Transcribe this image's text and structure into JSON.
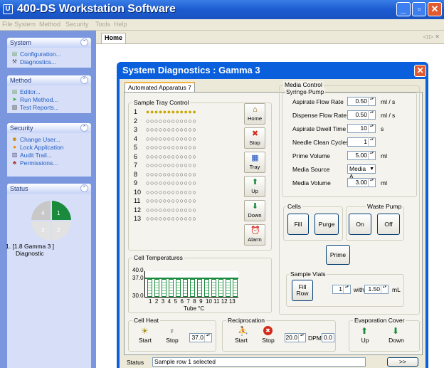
{
  "window": {
    "title": "400-DS Workstation Software",
    "icon_text": "U",
    "min": "_",
    "max": "▫",
    "close": "✕"
  },
  "menu": [
    "File",
    "System",
    "Method",
    "Security",
    "Tools",
    "Help"
  ],
  "sidebar": {
    "system": {
      "title": "System",
      "items": [
        "Configuration...",
        "Diagnostics..."
      ]
    },
    "method": {
      "title": "Method",
      "items": [
        "Editor...",
        "Run Method...",
        "Test Reports..."
      ]
    },
    "security": {
      "title": "Security",
      "items": [
        "Change User...",
        "Lock Application",
        "Audit Trail...",
        "Permissions..."
      ]
    },
    "status": {
      "title": "Status",
      "pie": [
        "4",
        "1",
        "3",
        "2"
      ],
      "line1": "1. [1.8 Gamma 3 ]",
      "line2": "Diagnostic"
    }
  },
  "main": {
    "tab": "Home",
    "nav": "◁ ▷ ✕"
  },
  "dialog": {
    "title": "System Diagnostics : Gamma 3",
    "tab": "Automated Apparatus 7",
    "tray": {
      "title": "Sample Tray Control",
      "rows": [
        "1",
        "2",
        "3",
        "4",
        "5",
        "6",
        "7",
        "8",
        "9",
        "10",
        "11",
        "12",
        "13"
      ],
      "buttons": [
        {
          "label": "Home",
          "icon": "home-icon",
          "glyph": "⌂"
        },
        {
          "label": "Stop",
          "icon": "stop-icon",
          "glyph": "✖"
        },
        {
          "label": "Tray",
          "icon": "tray-icon",
          "glyph": "▦"
        },
        {
          "label": "Up",
          "icon": "up-arrow-icon",
          "glyph": "⬆"
        },
        {
          "label": "Down",
          "icon": "down-arrow-icon",
          "glyph": "⬇"
        },
        {
          "label": "Alarm",
          "icon": "alarm-icon",
          "glyph": "⏰"
        }
      ]
    },
    "temps": {
      "title": "Cell Temperatures",
      "y_top": "40.0",
      "y_mid": "37.0",
      "y_bot": "30.0",
      "ticks": "1  2  3  4  5  6  7  8  9  10 11 12 13",
      "xlabel": "Tube °C"
    },
    "media": {
      "title": "Media Control",
      "syringe": "Syringe Pump",
      "fields": [
        {
          "label": "Aspirate Flow Rate",
          "value": "0.50",
          "unit": "ml / s"
        },
        {
          "label": "Dispense Flow Rate",
          "value": "0.50",
          "unit": "ml / s"
        },
        {
          "label": "Aspirate Dwell Time",
          "value": "10",
          "unit": "s"
        },
        {
          "label": "Needle Clean Cycles",
          "value": "1",
          "unit": ""
        },
        {
          "label": "Prime Volume",
          "value": "5.00",
          "unit": "ml"
        },
        {
          "label": "Media Source",
          "value": "Media A",
          "unit": ""
        },
        {
          "label": "Media Volume",
          "value": "3.00",
          "unit": "ml"
        }
      ]
    },
    "cells": {
      "title": "Cells",
      "fill": "Fill",
      "purge": "Purge"
    },
    "waste": {
      "title": "Waste Pump",
      "on": "On",
      "off": "Off"
    },
    "prime": "Prime",
    "vials": {
      "title": "Sample Vials",
      "fill_row": "Fill Row",
      "count": "1",
      "with": "with",
      "volume": "1.50",
      "unit": "mL"
    },
    "heat": {
      "title": "Cell Heat",
      "start": "Start",
      "stop": "Stop",
      "value": "37.0"
    },
    "recip": {
      "title": "Reciprocation",
      "start": "Start",
      "stop": "Stop",
      "dpm_set": "20.0",
      "dpm_label": "DPM",
      "dpm_read": "0.0"
    },
    "evap": {
      "title": "Evaporation Cover",
      "up": "Up",
      "down": "Down"
    },
    "status": {
      "label": "Status",
      "text": "Sample row 1 selected",
      "more": ">>"
    }
  },
  "colors": {
    "titlebar": "#1c5bd0",
    "sidebar": "#7a96df",
    "dialog_frame": "#0a5fdc",
    "green": "#1a8a3c",
    "red": "#d42a1a"
  }
}
